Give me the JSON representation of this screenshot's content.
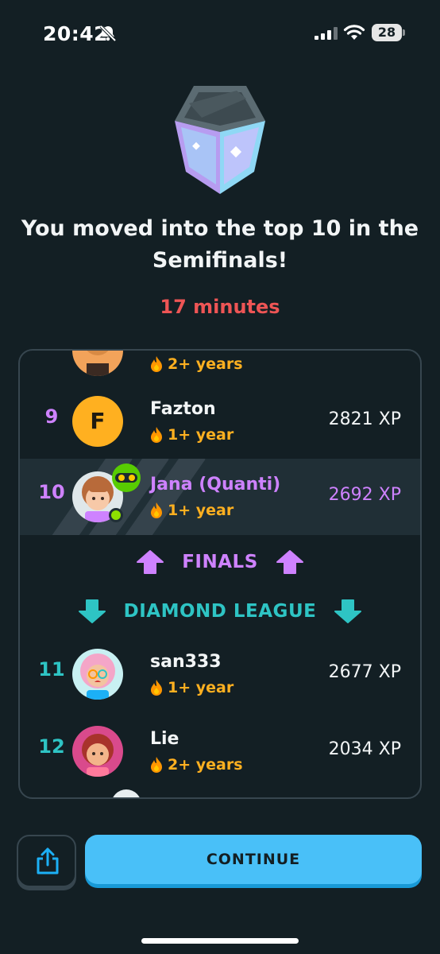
{
  "status_bar": {
    "time": "20:42",
    "battery": "28",
    "icons": [
      "bell-off-icon",
      "cellular-signal-icon",
      "wifi-icon",
      "battery-icon"
    ]
  },
  "badge": {
    "icon": "diamond-league-trophy-icon"
  },
  "headline": "You moved into the top 10 in the Semifinals!",
  "timer": "17 minutes",
  "colors": {
    "background": "#131f24",
    "timer": "#ee5555",
    "promotion": "#ce82ff",
    "demotion": "#2ec4c4",
    "streak": "#ffb020",
    "button": "#49c0f8"
  },
  "leaderboard": {
    "partial_top": {
      "streak": "2+ years"
    },
    "rows": [
      {
        "rank": "9",
        "avatar_letter": "F",
        "name": "Fazton",
        "streak": "1+ year",
        "xp": "2821 XP"
      },
      {
        "rank": "10",
        "name": "Jana (Quanti)",
        "streak": "1+ year",
        "xp": "2692 XP",
        "is_user": true,
        "online": true
      },
      {
        "rank": "11",
        "name": "san333",
        "streak": "1+ year",
        "xp": "2677 XP"
      },
      {
        "rank": "12",
        "name": "Lie",
        "streak": "2+ years",
        "xp": "2034 XP"
      }
    ],
    "promotion_label": "FINALS",
    "demotion_label": "DIAMOND LEAGUE"
  },
  "buttons": {
    "share_icon": "share-icon",
    "continue": "CONTINUE"
  }
}
